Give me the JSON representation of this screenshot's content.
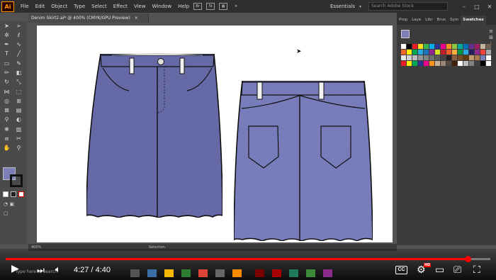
{
  "app": {
    "logo": "Ai",
    "menus": [
      "File",
      "Edit",
      "Object",
      "Type",
      "Select",
      "Effect",
      "View",
      "Window",
      "Help"
    ],
    "menubar_icons": [
      "Br",
      "St"
    ],
    "workspace": "Essentials",
    "stock_search_placeholder": "Search Adobe Stock",
    "window_buttons": [
      "–",
      "□",
      "✕"
    ]
  },
  "document": {
    "tab_title": "Denim Skirt2.ai* @ 400% (CMYK/GPU Preview)",
    "tab_close": "×"
  },
  "panels": {
    "tabs": [
      "Prop",
      "Laye",
      "Libr",
      "Brus",
      "Sym",
      "Swatches"
    ],
    "active_tab": "Swatches"
  },
  "status": {
    "zoom": "400%",
    "tool": "Selection"
  },
  "colors": {
    "denim": "#6b6fae",
    "denim_back": "#7e83c4",
    "accent_red": "#ff0000"
  },
  "video": {
    "time": "4:27 / 4:40",
    "progress": 0.9536,
    "cc_label": "CC",
    "hd_badge": "HD",
    "taskbar_text": "Type here to search"
  }
}
